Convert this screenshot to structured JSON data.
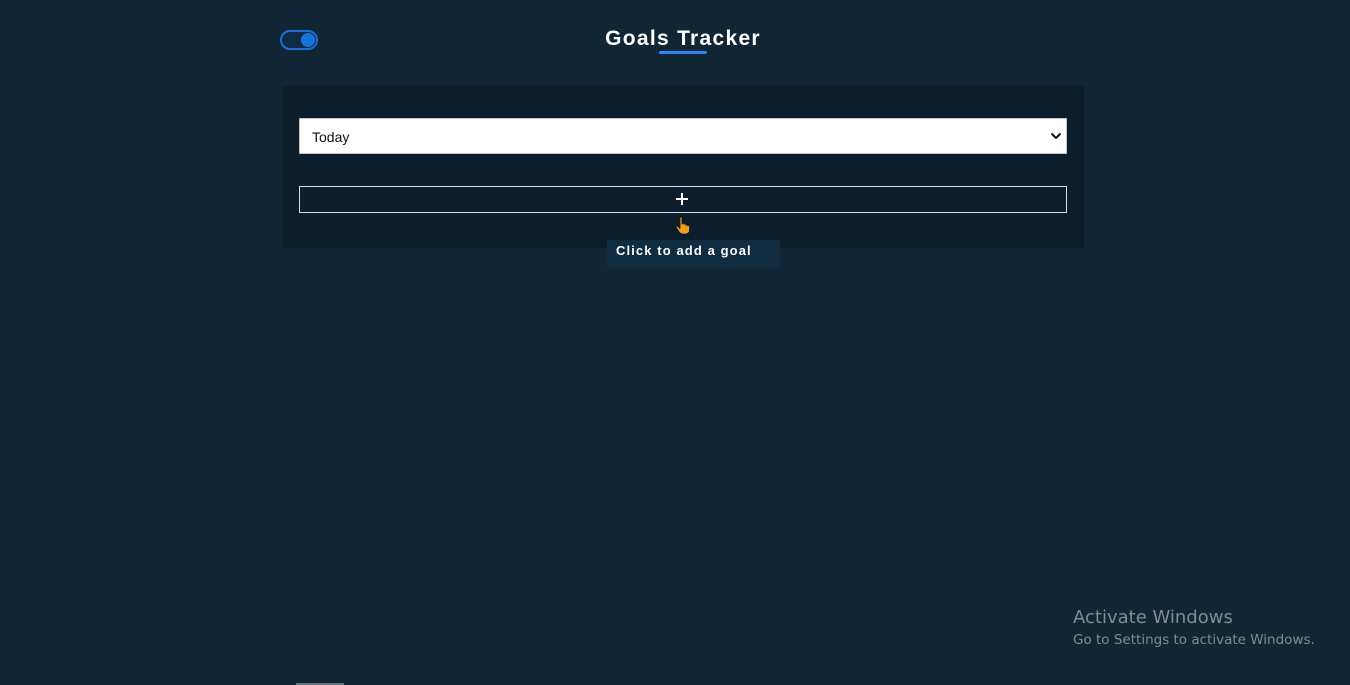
{
  "header": {
    "title": "Goals Tracker",
    "theme_toggle": {
      "state": "on",
      "icon": "toggle-switch"
    }
  },
  "period_select": {
    "selected": "Today",
    "icon": "chevron-down-icon"
  },
  "add_goal": {
    "label": "+",
    "icon": "plus-icon",
    "tooltip": "Click to add a goal",
    "cursor_icon": "pointer-hand-icon"
  },
  "watermark": {
    "title": "Activate Windows",
    "subtitle": "Go to Settings to activate Windows."
  },
  "colors": {
    "background": "#102635",
    "card": "#0c1e2c",
    "accent": "#1a74e0",
    "cursor": "#f0a020"
  }
}
